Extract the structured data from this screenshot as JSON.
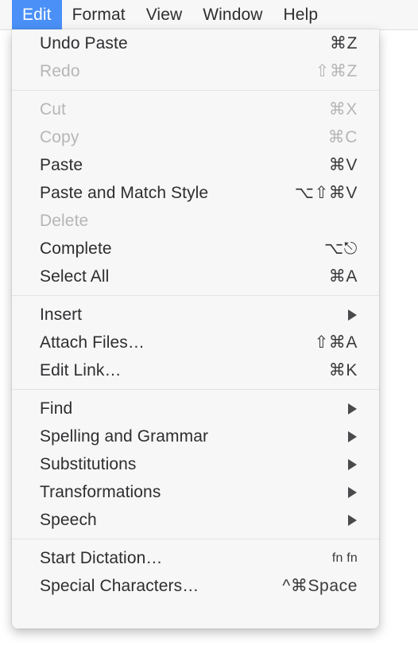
{
  "menubar": {
    "items": [
      {
        "label": "Edit",
        "active": true
      },
      {
        "label": "Format",
        "active": false
      },
      {
        "label": "View",
        "active": false
      },
      {
        "label": "Window",
        "active": false
      },
      {
        "label": "Help",
        "active": false
      }
    ]
  },
  "colors": {
    "highlight": "#4a90f7",
    "panel_background": "#f7f7f7",
    "menubar_background": "#f7f7f7",
    "text": "#2e2e31",
    "text_disabled": "#b6b6b8",
    "separator": "#e3e3e3"
  },
  "edit_menu": {
    "sections": [
      {
        "items": [
          {
            "label": "Undo Paste",
            "shortcut": "⌘Z",
            "disabled": false,
            "submenu": false
          },
          {
            "label": "Redo",
            "shortcut": "⇧⌘Z",
            "disabled": true,
            "submenu": false
          }
        ]
      },
      {
        "items": [
          {
            "label": "Cut",
            "shortcut": "⌘X",
            "disabled": true,
            "submenu": false
          },
          {
            "label": "Copy",
            "shortcut": "⌘C",
            "disabled": true,
            "submenu": false
          },
          {
            "label": "Paste",
            "shortcut": "⌘V",
            "disabled": false,
            "submenu": false
          },
          {
            "label": "Paste and Match Style",
            "shortcut": "⌥⇧⌘V",
            "disabled": false,
            "submenu": false
          },
          {
            "label": "Delete",
            "shortcut": "",
            "disabled": true,
            "submenu": false
          },
          {
            "label": "Complete",
            "shortcut": "⌥⎋",
            "disabled": false,
            "submenu": false
          },
          {
            "label": "Select All",
            "shortcut": "⌘A",
            "disabled": false,
            "submenu": false
          }
        ]
      },
      {
        "items": [
          {
            "label": "Insert",
            "shortcut": "",
            "disabled": false,
            "submenu": true
          },
          {
            "label": "Attach Files…",
            "shortcut": "⇧⌘A",
            "disabled": false,
            "submenu": false
          },
          {
            "label": "Edit Link…",
            "shortcut": "⌘K",
            "disabled": false,
            "submenu": false
          }
        ]
      },
      {
        "items": [
          {
            "label": "Find",
            "shortcut": "",
            "disabled": false,
            "submenu": true
          },
          {
            "label": "Spelling and Grammar",
            "shortcut": "",
            "disabled": false,
            "submenu": true
          },
          {
            "label": "Substitutions",
            "shortcut": "",
            "disabled": false,
            "submenu": true
          },
          {
            "label": "Transformations",
            "shortcut": "",
            "disabled": false,
            "submenu": true
          },
          {
            "label": "Speech",
            "shortcut": "",
            "disabled": false,
            "submenu": true
          }
        ]
      },
      {
        "items": [
          {
            "label": "Start Dictation…",
            "shortcut": "fn fn",
            "shortcut_small": true,
            "disabled": false,
            "submenu": false
          },
          {
            "label": "Special Characters…",
            "shortcut": "^⌘Space",
            "disabled": false,
            "submenu": false
          }
        ]
      }
    ]
  }
}
